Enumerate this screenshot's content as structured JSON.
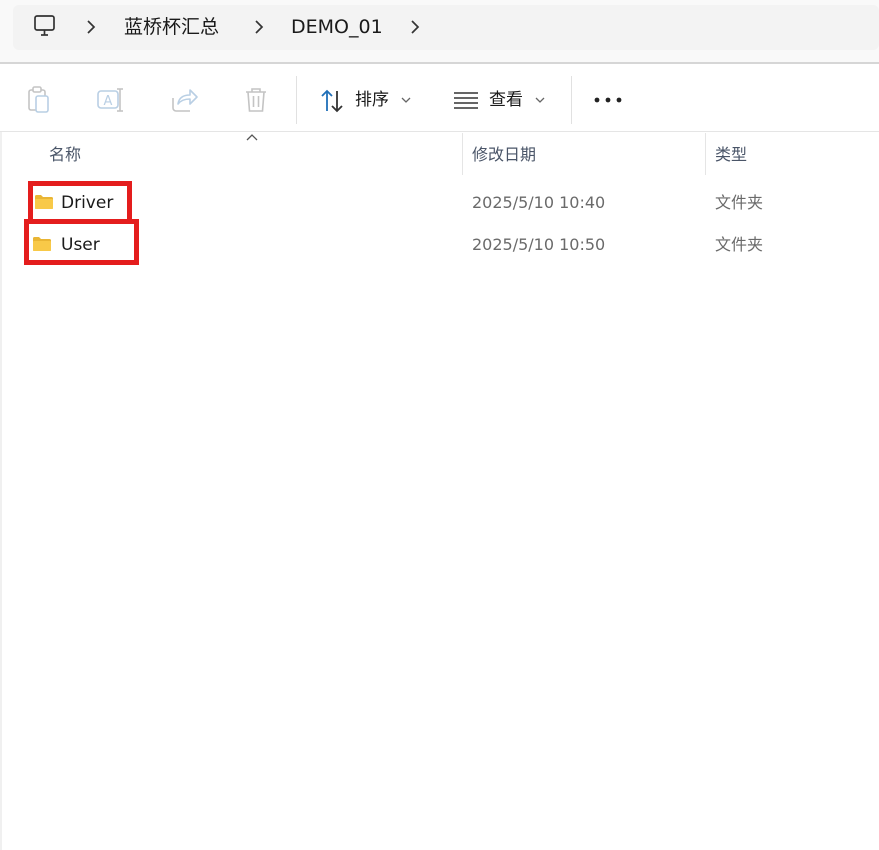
{
  "breadcrumb": {
    "items": [
      "蓝桥杯汇总",
      "DEMO_01"
    ]
  },
  "icons": {
    "computer": "monitor-icon",
    "chevron": "chevron-right-icon",
    "copy": "clipboard-icon",
    "rename": "rename-icon",
    "share": "share-icon",
    "delete": "trash-icon",
    "sort": "sort-icon",
    "view": "view-list-icon",
    "more": "more-dots-icon",
    "folder": "folder-icon"
  },
  "toolbar": {
    "sort_label": "排序",
    "view_label": "查看"
  },
  "columns": {
    "name": "名称",
    "modified": "修改日期",
    "type": "类型"
  },
  "files": [
    {
      "name": "Driver",
      "modified": "2025/5/10 10:40",
      "type": "文件夹"
    },
    {
      "name": "User",
      "modified": "2025/5/10 10:50",
      "type": "文件夹"
    }
  ],
  "colors": {
    "highlight": "#e41d1d",
    "folder": "#f8c948",
    "accent": "#1f6fb8"
  }
}
